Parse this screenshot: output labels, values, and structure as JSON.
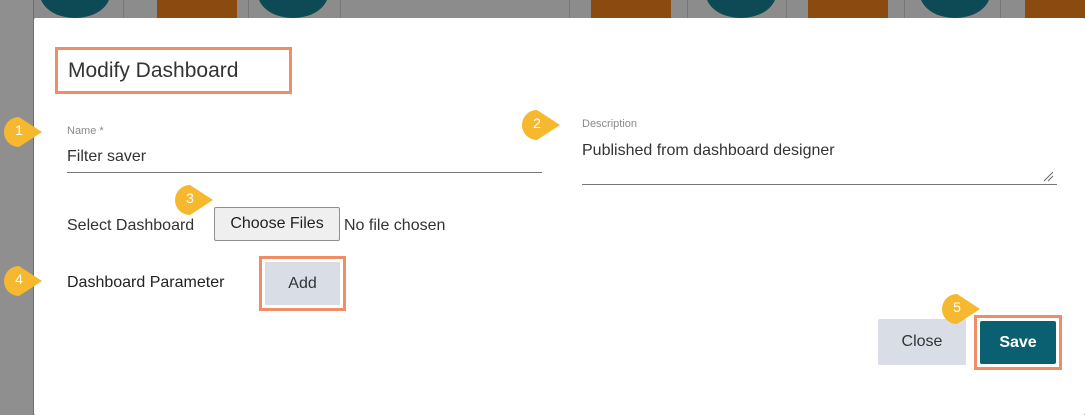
{
  "modal": {
    "title": "Modify Dashboard",
    "name_label": "Name *",
    "name_value": "Filter saver",
    "description_label": "Description",
    "description_value": "Published from dashboard designer",
    "select_dashboard_label": "Select Dashboard",
    "choose_files_label": "Choose Files",
    "no_file_text": "No file chosen",
    "dashboard_parameter_label": "Dashboard Parameter",
    "add_label": "Add",
    "close_label": "Close",
    "save_label": "Save"
  },
  "markers": [
    "1",
    "2",
    "3",
    "4",
    "5"
  ],
  "colors": {
    "marker": "#f5b82e",
    "highlight": "#ef8d66",
    "save": "#0a5f70",
    "secondary_button": "#d8dde6"
  }
}
